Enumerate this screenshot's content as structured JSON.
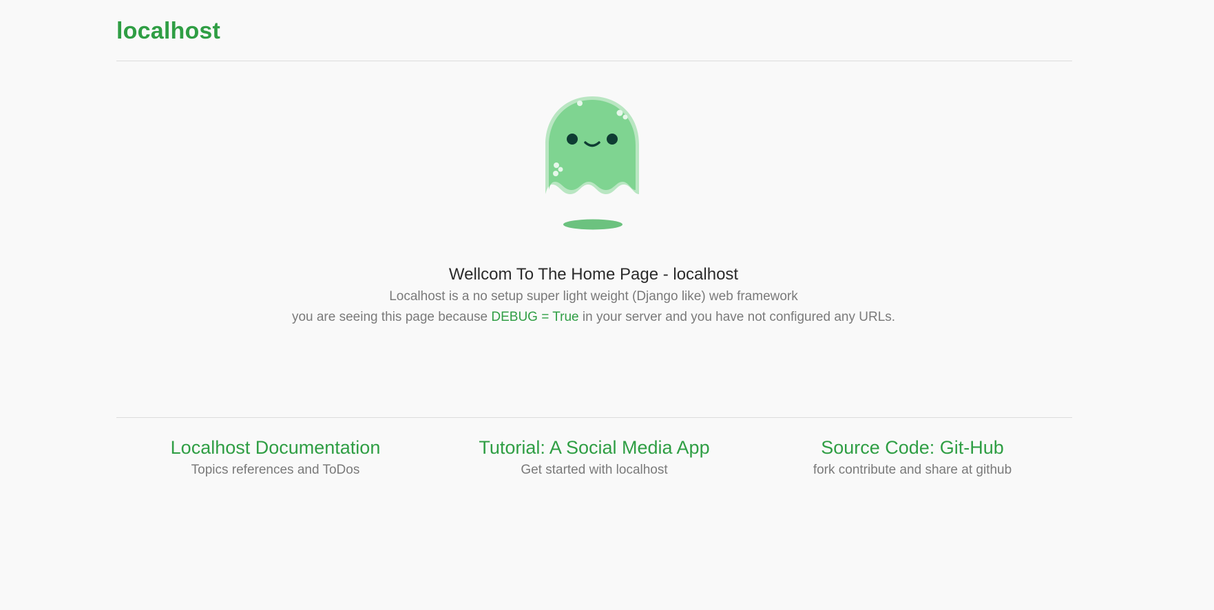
{
  "header": {
    "site_title": "localhost"
  },
  "hero": {
    "title": "Wellcom To The Home Page - localhost",
    "description": "Localhost is a no setup super light weight (Django like) web framework",
    "debug_prefix": "you are seeing this page because ",
    "debug_flag": "DEBUG = True",
    "debug_suffix": " in your server and you have not configured any URLs."
  },
  "mascot": {
    "icon": "ghost-icon",
    "body_color": "#7fd491",
    "outline_color": "#b9e6c2",
    "shadow_color": "#6cc27f",
    "feature_color": "#0f3d33"
  },
  "links": [
    {
      "title": "Localhost Documentation",
      "subtitle": "Topics references and ToDos"
    },
    {
      "title": "Tutorial: A Social Media App",
      "subtitle": "Get started with localhost"
    },
    {
      "title": "Source Code: Git-Hub",
      "subtitle": "fork contribute and share at github"
    }
  ],
  "colors": {
    "accent": "#2f9e44",
    "background": "#f9f9f9",
    "muted_text": "#7a7a7a",
    "heading_text": "#2b2b2b"
  }
}
